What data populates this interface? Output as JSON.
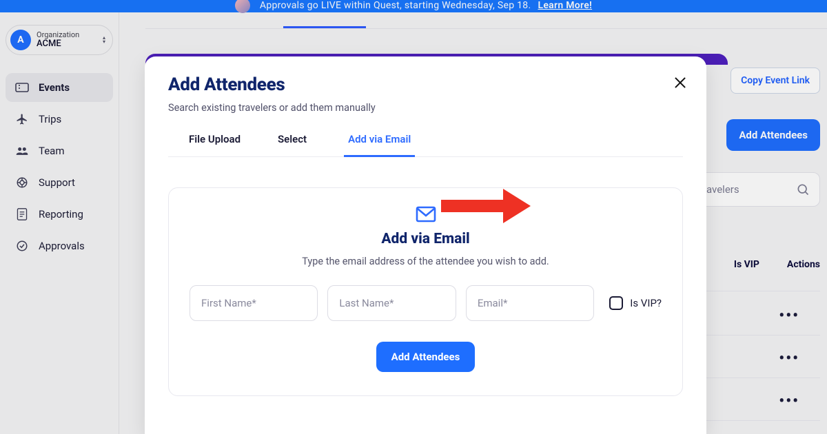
{
  "announcement": {
    "text": "Approvals go LIVE within Quest, starting Wednesday, Sep 18.",
    "link_label": "Learn More!"
  },
  "org": {
    "badge": "A",
    "label": "Organization",
    "name": "ACME"
  },
  "sidebar": {
    "items": [
      {
        "label": "Events",
        "icon": "ticket-icon",
        "active": true
      },
      {
        "label": "Trips",
        "icon": "plane-icon"
      },
      {
        "label": "Team",
        "icon": "team-icon"
      },
      {
        "label": "Support",
        "icon": "support-icon"
      },
      {
        "label": "Reporting",
        "icon": "reporting-icon"
      },
      {
        "label": "Approvals",
        "icon": "approvals-icon"
      }
    ]
  },
  "page": {
    "copy_link_label": "Copy Event Link",
    "add_attendees_label": "Add Attendees",
    "search_placeholder": "avelers",
    "columns": {
      "vip": "Is VIP",
      "actions": "Actions"
    },
    "row_menu": "•••"
  },
  "modal": {
    "title": "Add Attendees",
    "subtitle": "Search existing travelers or add them manually",
    "tabs": [
      {
        "label": "File Upload"
      },
      {
        "label": "Select"
      },
      {
        "label": "Add via Email",
        "active": true
      }
    ],
    "panel": {
      "heading": "Add via Email",
      "description": "Type the email address of the attendee you wish to add.",
      "first_name_ph": "First Name*",
      "last_name_ph": "Last Name*",
      "email_ph": "Email*",
      "vip_label": "Is VIP?",
      "submit_label": "Add Attendees"
    }
  }
}
